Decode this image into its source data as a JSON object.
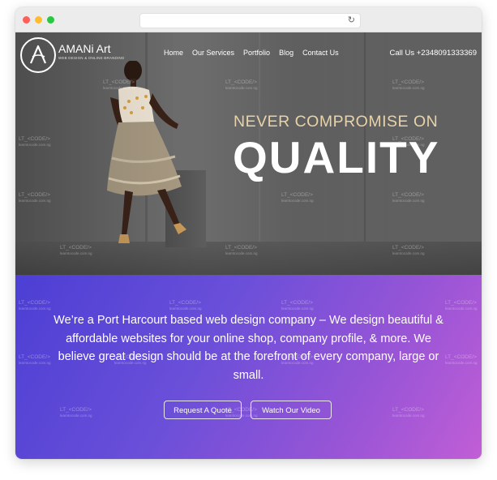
{
  "browser": {
    "reload_icon": "reload-icon",
    "traffic_lights": [
      "#fe5f57",
      "#febc2e",
      "#28c840"
    ]
  },
  "header": {
    "logo_icon": "amani-art-logo",
    "brand_name": "AMANi Art",
    "brand_tagline": "WEB DESIGN & ONLINE BRANDING",
    "nav": [
      {
        "label": "Home"
      },
      {
        "label": "Our Services"
      },
      {
        "label": "Portfolio"
      },
      {
        "label": "Blog"
      },
      {
        "label": "Contact Us"
      }
    ],
    "phone": "Call Us +2348091333369"
  },
  "hero": {
    "headline_top": "NEVER COMPROMISE ON",
    "headline_main": "QUALITY",
    "headline_top_color": "#e8d3a8"
  },
  "intro": {
    "text": "We’re a Port Harcourt based web design company – We design beautiful & affordable websites for your online shop, company profile, & more. We believe great design should be at the forefront of every company, large or small.",
    "buttons": {
      "quote": "Request A Quote",
      "video": "Watch Our Video"
    },
    "gradient": [
      "#4c3fd4",
      "#c15ed6"
    ]
  },
  "watermark": {
    "text": "LT_<CODE/>",
    "sub": "learntocode.com.ng"
  }
}
